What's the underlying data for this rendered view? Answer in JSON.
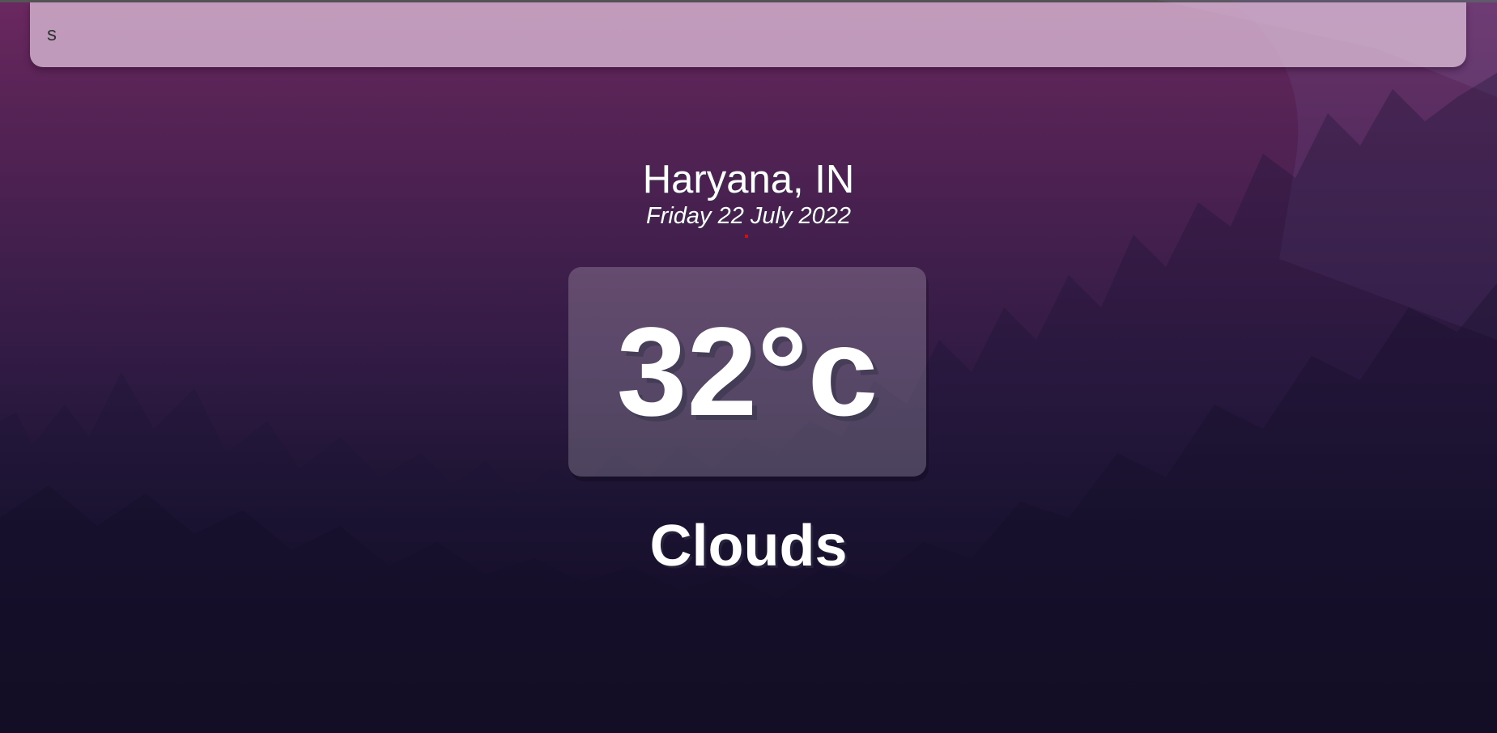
{
  "search": {
    "value": "s",
    "placeholder": ""
  },
  "location": {
    "city_country": "Haryana, IN",
    "date": "Friday 22 July 2022"
  },
  "weather": {
    "temperature": "32°c",
    "condition": "Clouds"
  },
  "colors": {
    "background_top": "#6b2860",
    "background_bottom": "#0e0a1c",
    "text": "#ffffff"
  }
}
